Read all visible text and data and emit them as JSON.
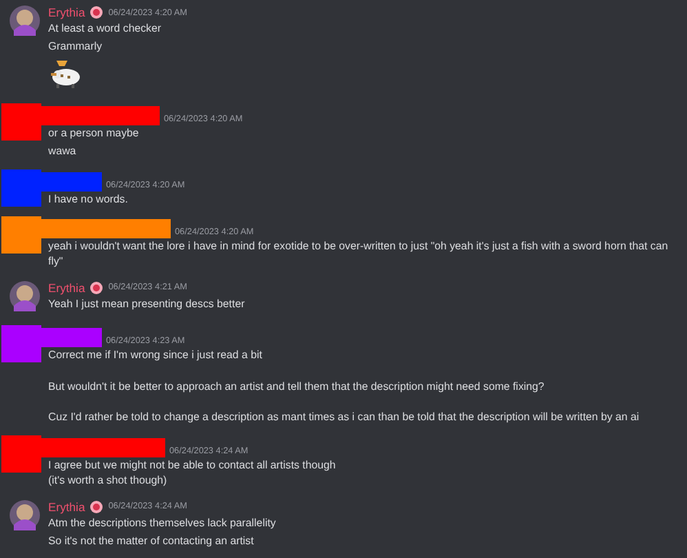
{
  "messages": [
    {
      "author": {
        "kind": "named",
        "name": "Erythia",
        "color": "#f0506e"
      },
      "timestamp": "06/24/2023 4:20 AM",
      "items": [
        {
          "kind": "text",
          "text": "At least a word checker"
        },
        {
          "kind": "text",
          "text": "Grammarly"
        },
        {
          "kind": "sticker"
        }
      ]
    },
    {
      "author": {
        "kind": "redacted",
        "color": "#ff0000"
      },
      "timestamp": "06/24/2023 4:20 AM",
      "items": [
        {
          "kind": "text",
          "text": "or a person maybe"
        },
        {
          "kind": "text",
          "text": "wawa"
        }
      ]
    },
    {
      "author": {
        "kind": "redacted",
        "color": "#0022ff"
      },
      "timestamp": "06/24/2023 4:20 AM",
      "items": [
        {
          "kind": "text",
          "text": "I have no words."
        }
      ]
    },
    {
      "author": {
        "kind": "redacted",
        "color": "#ff7f00"
      },
      "timestamp": "06/24/2023 4:20 AM",
      "items": [
        {
          "kind": "text",
          "text": "yeah i wouldn't want the lore i have in mind for exotide to be over-written to just \"oh yeah it's just a fish with a sword horn that can fly\""
        }
      ]
    },
    {
      "author": {
        "kind": "named",
        "name": "Erythia",
        "color": "#f0506e"
      },
      "timestamp": "06/24/2023 4:21 AM",
      "items": [
        {
          "kind": "text",
          "text": "Yeah I just mean presenting descs better"
        }
      ]
    },
    {
      "author": {
        "kind": "redacted",
        "color": "#aa00ff"
      },
      "timestamp": "06/24/2023 4:23 AM",
      "items": [
        {
          "kind": "text",
          "text": "Correct me if I'm wrong since i just read a bit\n\nBut wouldn't it be better to approach an artist and tell them that the description might need some fixing?\n\nCuz I'd rather be told to change a description as mant times as i can than be told that the description will be written by an ai"
        }
      ]
    },
    {
      "author": {
        "kind": "redacted",
        "color": "#ff0000"
      },
      "timestamp": "06/24/2023 4:24 AM",
      "items": [
        {
          "kind": "text",
          "text": "I agree but we might not be able to contact all artists though\n(it's worth a shot though)"
        }
      ]
    },
    {
      "author": {
        "kind": "named",
        "name": "Erythia",
        "color": "#f0506e"
      },
      "timestamp": "06/24/2023 4:24 AM",
      "items": [
        {
          "kind": "text",
          "text": "Atm the descriptions themselves lack parallelity"
        },
        {
          "kind": "text",
          "text": "So it's not the matter of contacting an artist"
        }
      ]
    }
  ]
}
